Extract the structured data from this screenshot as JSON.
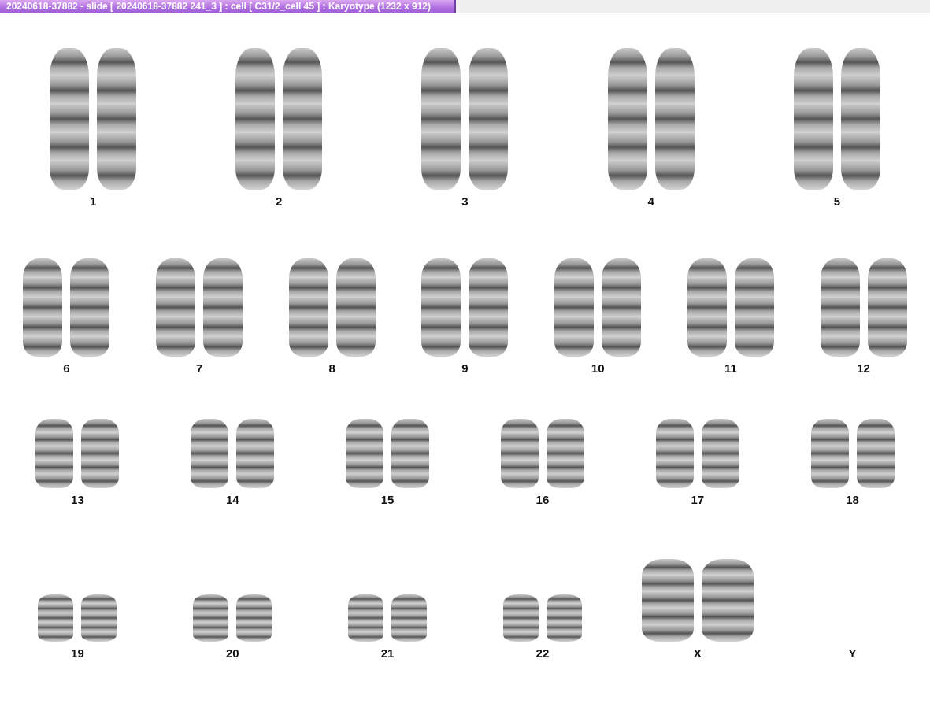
{
  "window": {
    "title": "20240618-37882 - slide [ 20240618-37882 241_3 ] : cell [ C31/2_cell 45 ] : Karyotype  (1232 x 912)"
  },
  "karyotype": {
    "rows": [
      {
        "groups": [
          {
            "label": "1",
            "pair": true
          },
          {
            "label": "2",
            "pair": true
          },
          {
            "label": "3",
            "pair": true
          },
          {
            "label": "4",
            "pair": true
          },
          {
            "label": "5",
            "pair": true
          }
        ]
      },
      {
        "groups": [
          {
            "label": "6",
            "pair": true
          },
          {
            "label": "7",
            "pair": true
          },
          {
            "label": "8",
            "pair": true
          },
          {
            "label": "9",
            "pair": true
          },
          {
            "label": "10",
            "pair": true
          },
          {
            "label": "11",
            "pair": true
          },
          {
            "label": "12",
            "pair": true
          }
        ]
      },
      {
        "groups": [
          {
            "label": "13",
            "pair": true
          },
          {
            "label": "14",
            "pair": true
          },
          {
            "label": "15",
            "pair": true
          },
          {
            "label": "16",
            "pair": true
          },
          {
            "label": "17",
            "pair": true
          },
          {
            "label": "18",
            "pair": true
          }
        ]
      },
      {
        "groups": [
          {
            "label": "19",
            "pair": true
          },
          {
            "label": "20",
            "pair": true
          },
          {
            "label": "21",
            "pair": true
          },
          {
            "label": "22",
            "pair": true
          },
          {
            "label": "X",
            "pair": true
          },
          {
            "label": "Y",
            "pair": false
          }
        ]
      }
    ]
  }
}
